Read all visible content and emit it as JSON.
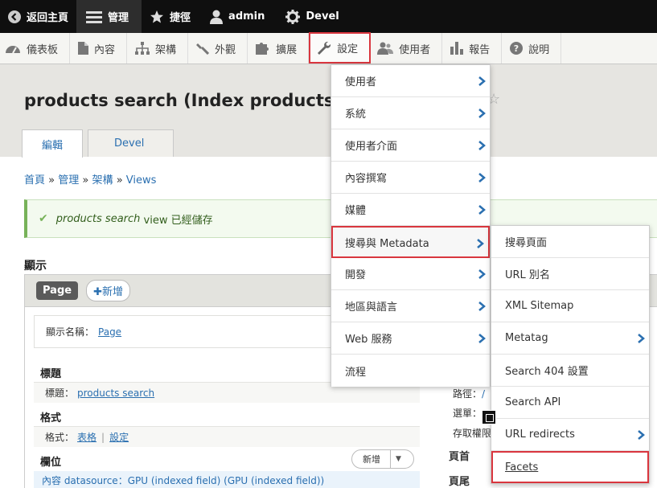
{
  "toolbar": {
    "back": "返回主頁",
    "manage": "管理",
    "shortcuts": "捷徑",
    "user": "admin",
    "devel": "Devel"
  },
  "tray": {
    "dashboard": "儀表板",
    "content": "內容",
    "structure": "架構",
    "appearance": "外觀",
    "extend": "擴展",
    "config": "設定",
    "people": "使用者",
    "reports": "報告",
    "help": "說明"
  },
  "page": {
    "title": "products search (Index products fa",
    "tabs": [
      "編輯",
      "Devel"
    ]
  },
  "breadcrumb": {
    "items": [
      "首頁",
      "管理",
      "架構",
      "Views"
    ],
    "separator": "»"
  },
  "status": {
    "view_name": "products search",
    "message_rest": " view 已經儲存"
  },
  "displays": {
    "section_title": "顯示",
    "page_tab": "Page",
    "add_label": "新增",
    "display_name_label": "顯示名稱：",
    "display_name_value": "Page"
  },
  "blocks": {
    "title_heading": "標題",
    "title_label": "標題：",
    "title_value": "products search",
    "format_heading": "格式",
    "format_label": "格式：",
    "format_value": "表格",
    "format_settings": "設定",
    "fields_heading": "欄位",
    "add_field": "新增",
    "field_row": "內容 datasource：GPU (indexed field) (GPU (indexed field))"
  },
  "right_col": {
    "path_label": "路徑：",
    "path_value": "/",
    "menu_label": "選單：",
    "access_label": "存取權限",
    "header_label": "頁首",
    "footer_label": "頁尾"
  },
  "config_menu": {
    "items": [
      "使用者",
      "系統",
      "使用者介面",
      "內容撰寫",
      "媒體",
      "搜尋與 Metadata",
      "開發",
      "地區與語言",
      "Web 服務",
      "流程"
    ]
  },
  "search_submenu": {
    "items": [
      "搜尋頁面",
      "URL 別名",
      "XML Sitemap",
      "Metatag",
      "Search 404 設置",
      "Search API",
      "URL redirects",
      "Facets"
    ]
  },
  "colors": {
    "accent_red": "#d9363e",
    "link_blue": "#2a6fb0",
    "success_green": "#77b259"
  }
}
